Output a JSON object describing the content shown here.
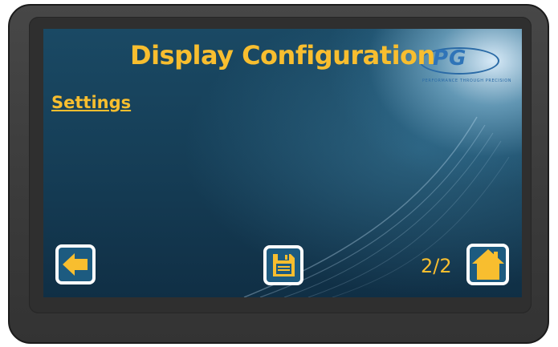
{
  "screen": {
    "title": "Display Configuration",
    "section_heading": "Settings",
    "page_indicator": "2/2"
  },
  "logo": {
    "letters": "PG",
    "tagline": "PERFORMANCE THROUGH PRECISION"
  },
  "buttons": {
    "back": {
      "icon": "arrow-left-icon"
    },
    "save": {
      "icon": "floppy-disk-icon"
    },
    "home": {
      "icon": "home-icon"
    }
  },
  "colors": {
    "accent": "#f8be2f",
    "button_fill": "#1d5b80",
    "button_border": "#ffffff",
    "bezel": "#3a3a3a",
    "screen_background": "#163f58"
  }
}
